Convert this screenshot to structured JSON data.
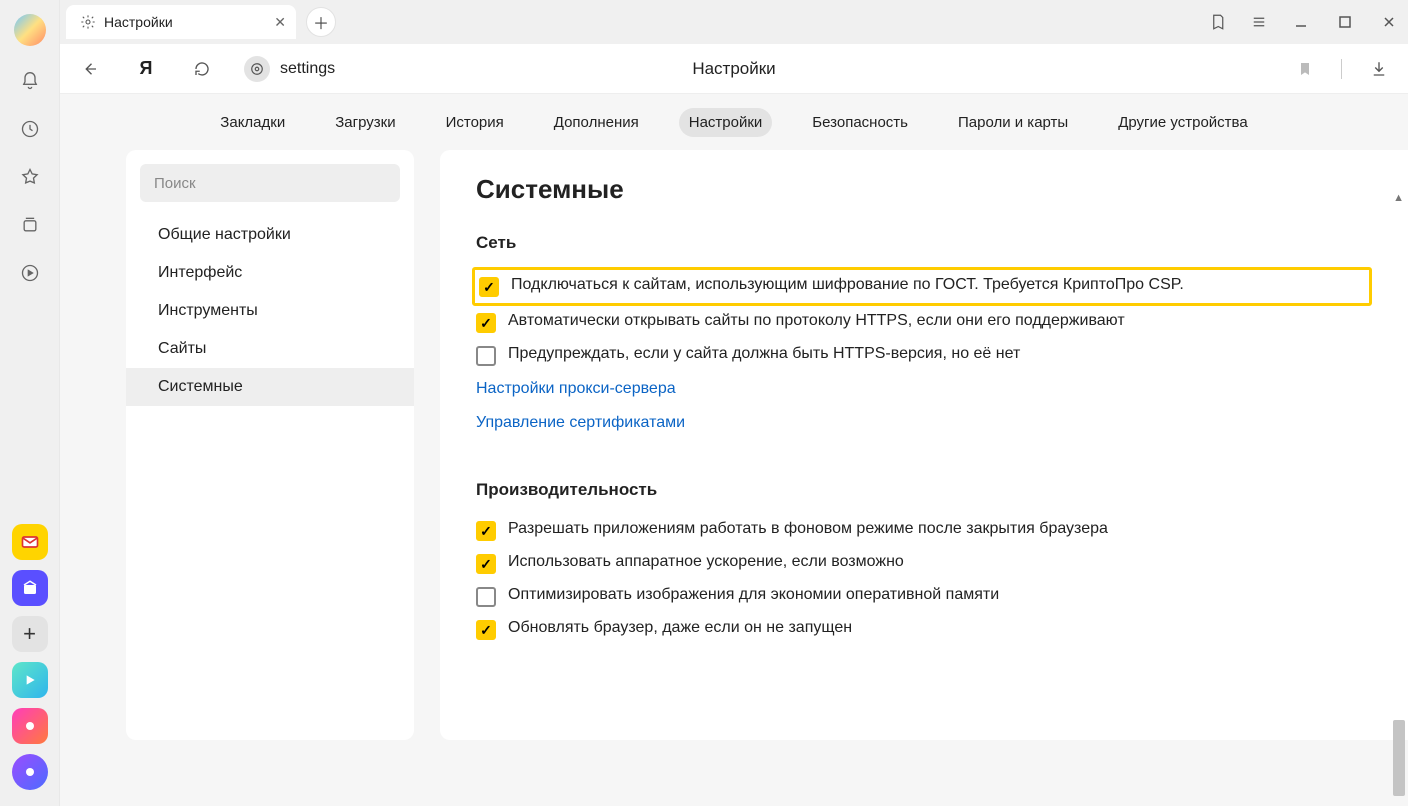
{
  "tab": {
    "title": "Настройки"
  },
  "address": {
    "text": "settings",
    "page_title": "Настройки"
  },
  "top_menu": {
    "items": [
      "Закладки",
      "Загрузки",
      "История",
      "Дополнения",
      "Настройки",
      "Безопасность",
      "Пароли и карты",
      "Другие устройства"
    ],
    "active_index": 4
  },
  "sidebar": {
    "search_placeholder": "Поиск",
    "items": [
      "Общие настройки",
      "Интерфейс",
      "Инструменты",
      "Сайты",
      "Системные"
    ],
    "active_index": 4
  },
  "settings": {
    "heading": "Системные",
    "network": {
      "title": "Сеть",
      "options": [
        {
          "label": "Подключаться к сайтам, использующим шифрование по ГОСТ. Требуется КриптоПро CSP.",
          "checked": true,
          "highlight": true
        },
        {
          "label": "Автоматически открывать сайты по протоколу HTTPS, если они его поддерживают",
          "checked": true,
          "highlight": false
        },
        {
          "label": "Предупреждать, если у сайта должна быть HTTPS-версия, но её нет",
          "checked": false,
          "highlight": false
        }
      ],
      "links": [
        "Настройки прокси-сервера",
        "Управление сертификатами"
      ]
    },
    "performance": {
      "title": "Производительность",
      "options": [
        {
          "label": "Разрешать приложениям работать в фоновом режиме после закрытия браузера",
          "checked": true
        },
        {
          "label": "Использовать аппаратное ускорение, если возможно",
          "checked": true
        },
        {
          "label": "Оптимизировать изображения для экономии оперативной памяти",
          "checked": false
        },
        {
          "label": "Обновлять браузер, даже если он не запущен",
          "checked": true
        }
      ]
    }
  }
}
